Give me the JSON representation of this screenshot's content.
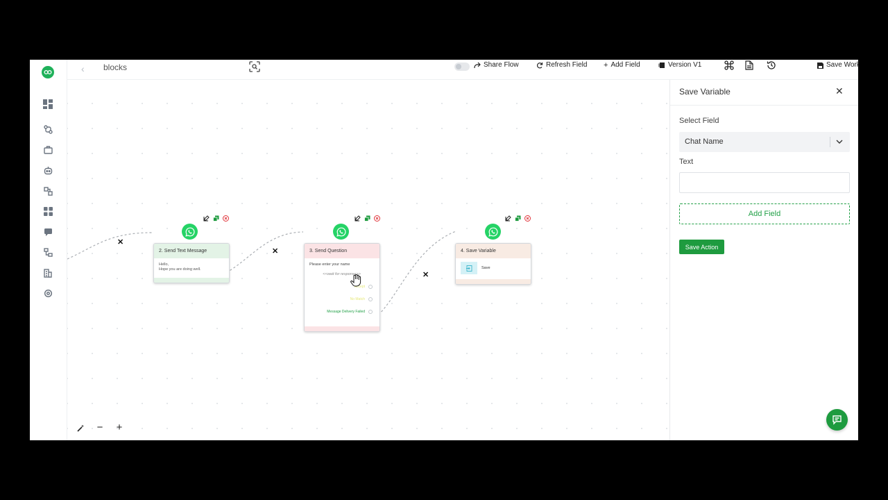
{
  "app": {
    "breadcrumb": "blocks",
    "toolbar": {
      "share_flow": "Share Flow",
      "refresh_field": "Refresh Field",
      "add_field": "Add Field",
      "version": "Version V1",
      "save_workflow": "Save Workflow"
    }
  },
  "sidebar": {
    "items": [
      {
        "icon": "dashboard-icon"
      },
      {
        "icon": "flow-icon"
      },
      {
        "icon": "briefcase-icon"
      },
      {
        "icon": "bot-icon"
      },
      {
        "icon": "blocks-icon"
      },
      {
        "icon": "apps-icon"
      },
      {
        "icon": "chat-icon"
      },
      {
        "icon": "hierarchy-icon"
      },
      {
        "icon": "building-icon"
      },
      {
        "icon": "settings-icon"
      }
    ]
  },
  "nodes": [
    {
      "title": "2. Send Text Message",
      "body_lines": [
        "Hello,",
        "Hope you are doing well."
      ],
      "head_color": "#e3f3e6",
      "foot_color": "#e3f3e6"
    },
    {
      "title": "3. Send Question",
      "prompt": "Please enter your name",
      "wait_text": "<<wait for response>>",
      "options": [
        {
          "label": "Accept",
          "color": "#e6e87a"
        },
        {
          "label": "No Match",
          "color": "#e6e87a"
        },
        {
          "label": "Message Delivery Failed",
          "color": "#22a047"
        }
      ],
      "head_color": "#fbe3e5",
      "foot_color": "#fbe3e5"
    },
    {
      "title": "4. Save Variable",
      "item_label": "Save",
      "head_color": "#f8ebe3",
      "foot_color": "#f8ebe3"
    }
  ],
  "panel": {
    "title": "Save Variable",
    "select_field_label": "Select Field",
    "select_field_value": "Chat Name",
    "text_label": "Text",
    "text_value": "",
    "add_field_button": "Add Field",
    "save_action_button": "Save Action"
  },
  "colors": {
    "brand_green": "#1e9b3f",
    "whatsapp_green": "#25d366",
    "delete_red": "#e0353b"
  }
}
